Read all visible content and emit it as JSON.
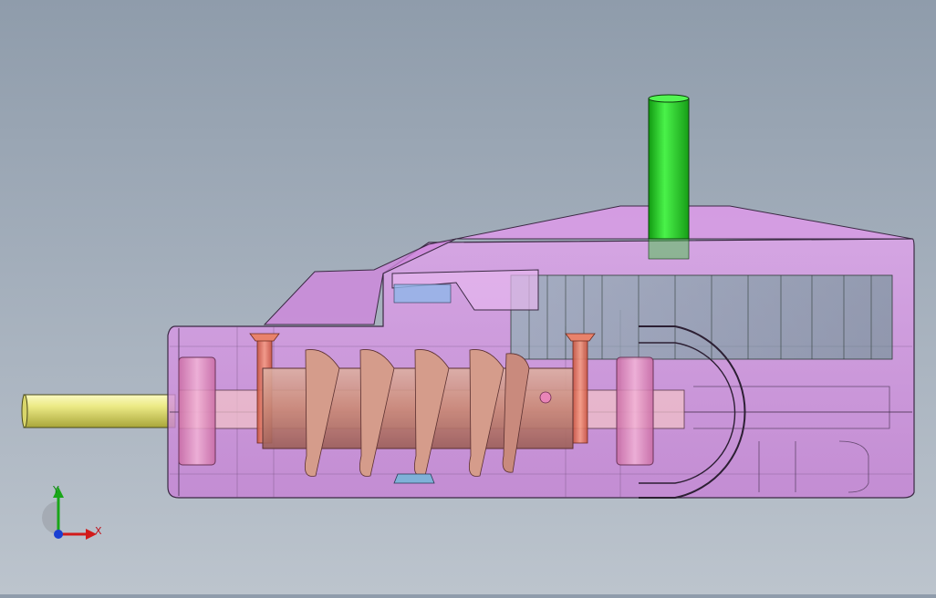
{
  "view": {
    "model": "worm-gear-reducer",
    "render_mode": "transparent-shaded-with-edges",
    "colors": {
      "housing": "#d88be6",
      "housing_edge": "#3b2a44",
      "output_shaft": "#2fd12f",
      "input_shaft": "#e8e67a",
      "worm": "#c98a7d",
      "pins": "#e9826b",
      "bearings": "#e7a0c8",
      "background_top": "#8f9cab",
      "background_bottom": "#bcc4cd"
    }
  },
  "triad": {
    "x_label": "X",
    "y_label": "Y",
    "x_color": "#d21a1a",
    "y_color": "#19a619",
    "z_color": "#1a3fd2"
  }
}
